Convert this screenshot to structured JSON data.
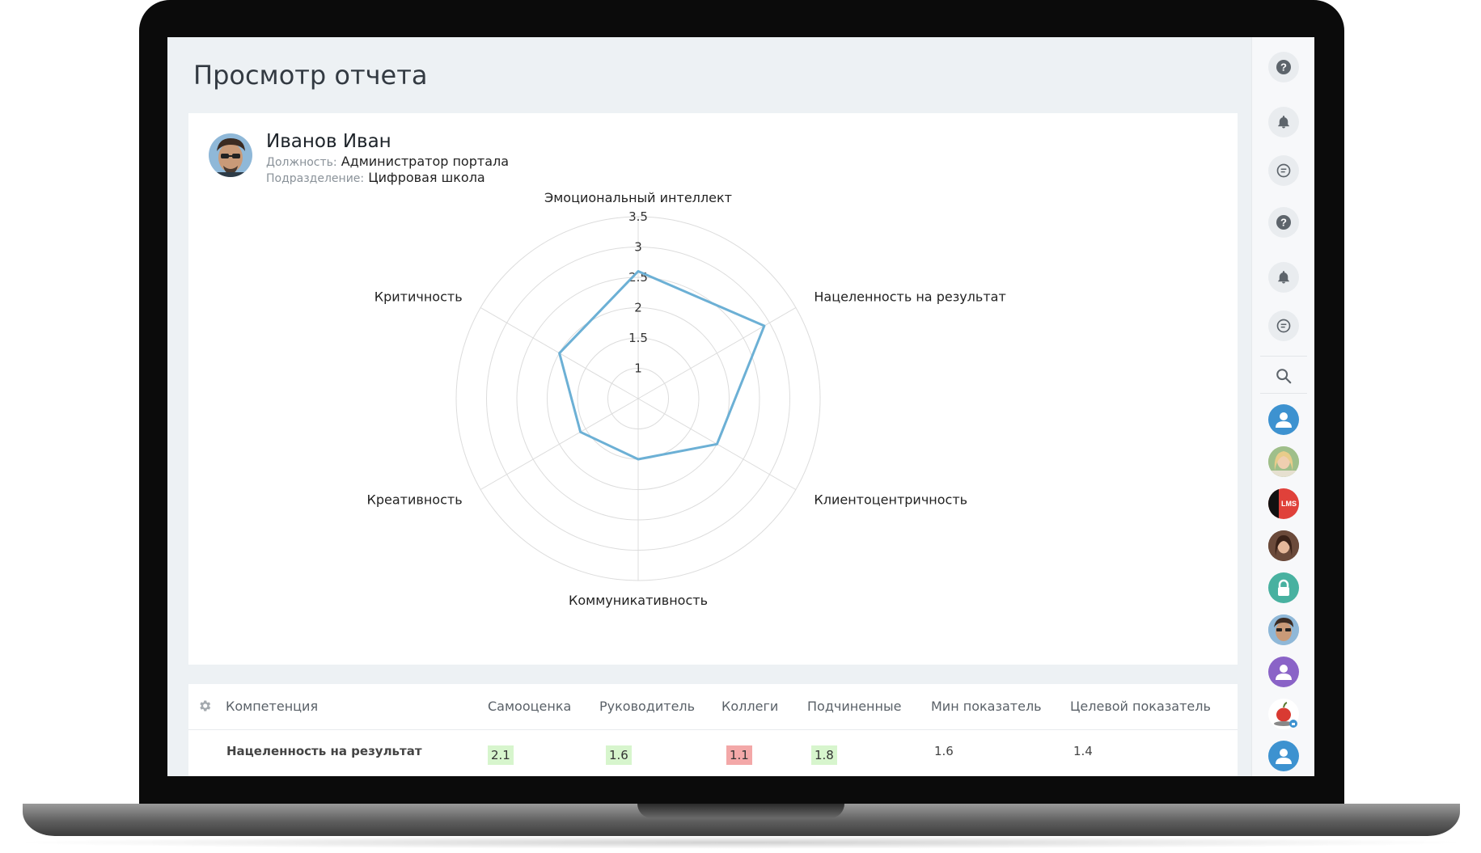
{
  "page": {
    "title": "Просмотр отчета"
  },
  "person": {
    "name": "Иванов Иван",
    "position_label": "Должность:",
    "position": "Администратор портала",
    "department_label": "Подразделение:",
    "department": "Цифровая школа"
  },
  "chart_data": {
    "type": "radar",
    "categories": [
      "Эмоциональный интеллект",
      "Нацеленность на результат",
      "Клиентоцентричность",
      "Коммуникативность",
      "Креативность",
      "Критичность"
    ],
    "series": [
      {
        "values": [
          2.6,
          2.9,
          2.0,
          1.5,
          1.6,
          2.0
        ],
        "color": "#6cb0d5"
      }
    ],
    "rlim": [
      1,
      3.5
    ],
    "ticks": [
      "1",
      "1.5",
      "2",
      "2.5",
      "3",
      "3.5"
    ],
    "tick_values": [
      1,
      1.5,
      2,
      2.5,
      3,
      3.5
    ],
    "grid": true
  },
  "table": {
    "headers": {
      "competence": "Компетенция",
      "self": "Самооценка",
      "manager": "Руководитель",
      "colleagues": "Коллеги",
      "subordinates": "Подчиненные",
      "min": "Мин показатель",
      "target": "Целевой показатель"
    },
    "rows": [
      {
        "competence": "Нацеленность на результат",
        "self": "2.1",
        "manager": "1.6",
        "colleagues": "1.1",
        "subordinates": "1.8",
        "min": "1.6",
        "target": "1.4"
      }
    ]
  },
  "rail": {
    "icons": [
      "help-icon",
      "bell-icon",
      "chat-icon",
      "help-icon",
      "bell-icon",
      "chat-icon",
      "search-icon"
    ],
    "avatars": [
      "user-icon",
      "photo-avatar",
      "lms-logo",
      "photo-avatar",
      "lock-icon",
      "photo-avatar",
      "user-icon",
      "apple-icon",
      "user-icon"
    ],
    "lms_text": "LMS",
    "colors": {
      "blue": "#3d92d0",
      "teal": "#48b1a0",
      "purple": "#8a63c7",
      "lms_red": "#e0413a"
    }
  }
}
